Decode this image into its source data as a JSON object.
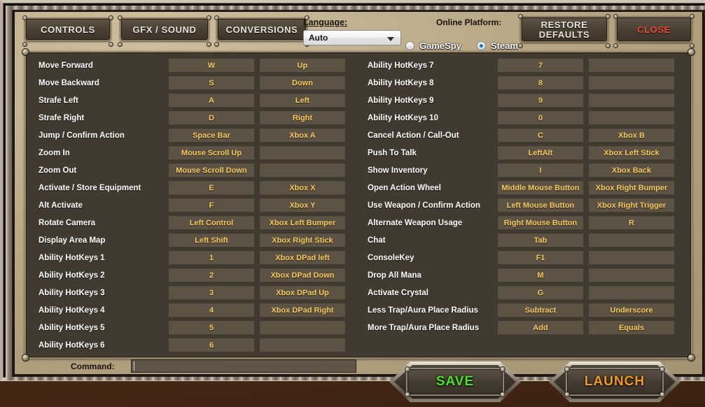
{
  "window": {
    "tabs": [
      {
        "id": "controls",
        "label": "CONTROLS"
      },
      {
        "id": "gfx",
        "label": "GFX / SOUND"
      },
      {
        "id": "conversions",
        "label": "CONVERSIONS"
      }
    ],
    "language": {
      "label": "Language:",
      "value": "Auto",
      "options": [
        "Auto"
      ]
    },
    "online_platform": {
      "label": "Online Platform:",
      "options": [
        {
          "label": "GameSpy",
          "selected": false
        },
        {
          "label": "Steam",
          "selected": true
        }
      ]
    },
    "restore_defaults_label": "RESTORE\nDEFAULTS",
    "restore_line1": "RESTORE",
    "restore_line2": "DEFAULTS",
    "close_label": "CLOSE",
    "command_label": "Command:",
    "command_value": "",
    "save_label": "SAVE",
    "launch_label": "LAUNCH"
  },
  "colors": {
    "accent_key_text": "#f5c963",
    "close_red": "#ef4b36",
    "save_green": "#4ce22a",
    "launch_orange": "#f59a21",
    "panel_bg": "#413a31",
    "cell_bg": "#5c5344",
    "radio_selected": "#1079d2"
  },
  "bindings": {
    "left": [
      {
        "action": "Move Forward",
        "primary": "W",
        "secondary": "Up"
      },
      {
        "action": "Move Backward",
        "primary": "S",
        "secondary": "Down"
      },
      {
        "action": "Strafe Left",
        "primary": "A",
        "secondary": "Left"
      },
      {
        "action": "Strafe Right",
        "primary": "D",
        "secondary": "Right"
      },
      {
        "action": "Jump / Confirm Action",
        "primary": "Space Bar",
        "secondary": "Xbox A"
      },
      {
        "action": "Zoom In",
        "primary": "Mouse Scroll Up",
        "secondary": ""
      },
      {
        "action": "Zoom Out",
        "primary": "Mouse Scroll Down",
        "secondary": ""
      },
      {
        "action": "Activate / Store Equipment",
        "primary": "E",
        "secondary": "Xbox X"
      },
      {
        "action": "Alt Activate",
        "primary": "F",
        "secondary": "Xbox Y"
      },
      {
        "action": "Rotate Camera",
        "primary": "Left Control",
        "secondary": "Xbox Left Bumper"
      },
      {
        "action": "Display Area Map",
        "primary": "Left Shift",
        "secondary": "Xbox Right Stick"
      },
      {
        "action": "Ability HotKeys 1",
        "primary": "1",
        "secondary": "Xbox DPad left"
      },
      {
        "action": "Ability HotKeys 2",
        "primary": "2",
        "secondary": "Xbox DPad Down"
      },
      {
        "action": "Ability HotKeys 3",
        "primary": "3",
        "secondary": "Xbox DPad Up"
      },
      {
        "action": "Ability HotKeys 4",
        "primary": "4",
        "secondary": "Xbox DPad Right"
      },
      {
        "action": "Ability HotKeys 5",
        "primary": "5",
        "secondary": ""
      },
      {
        "action": "Ability HotKeys 6",
        "primary": "6",
        "secondary": ""
      }
    ],
    "right": [
      {
        "action": "Ability HotKeys 7",
        "primary": "7",
        "secondary": ""
      },
      {
        "action": "Ability HotKeys 8",
        "primary": "8",
        "secondary": ""
      },
      {
        "action": "Ability HotKeys 9",
        "primary": "9",
        "secondary": ""
      },
      {
        "action": "Ability HotKeys 10",
        "primary": "0",
        "secondary": ""
      },
      {
        "action": "Cancel Action / Call-Out",
        "primary": "C",
        "secondary": "Xbox B"
      },
      {
        "action": "Push To Talk",
        "primary": "LeftAlt",
        "secondary": "Xbox Left Stick"
      },
      {
        "action": "Show Inventory",
        "primary": "I",
        "secondary": "Xbox Back"
      },
      {
        "action": "Open Action Wheel",
        "primary": "Middle Mouse Button",
        "secondary": "Xbox Right Bumper"
      },
      {
        "action": "Use Weapon / Confirm Action",
        "primary": "Left Mouse Button",
        "secondary": "Xbox Right Trigger"
      },
      {
        "action": "Alternate Weapon Usage",
        "primary": "Right Mouse Button",
        "secondary": "R"
      },
      {
        "action": "Chat",
        "primary": "Tab",
        "secondary": ""
      },
      {
        "action": "ConsoleKey",
        "primary": "F1",
        "secondary": ""
      },
      {
        "action": "Drop All Mana",
        "primary": "M",
        "secondary": ""
      },
      {
        "action": "Activate Crystal",
        "primary": "G",
        "secondary": ""
      },
      {
        "action": "Less Trap/Aura Place Radius",
        "primary": "Subtract",
        "secondary": "Underscore"
      },
      {
        "action": "More Trap/Aura Place Radius",
        "primary": "Add",
        "secondary": "Equals"
      }
    ]
  }
}
